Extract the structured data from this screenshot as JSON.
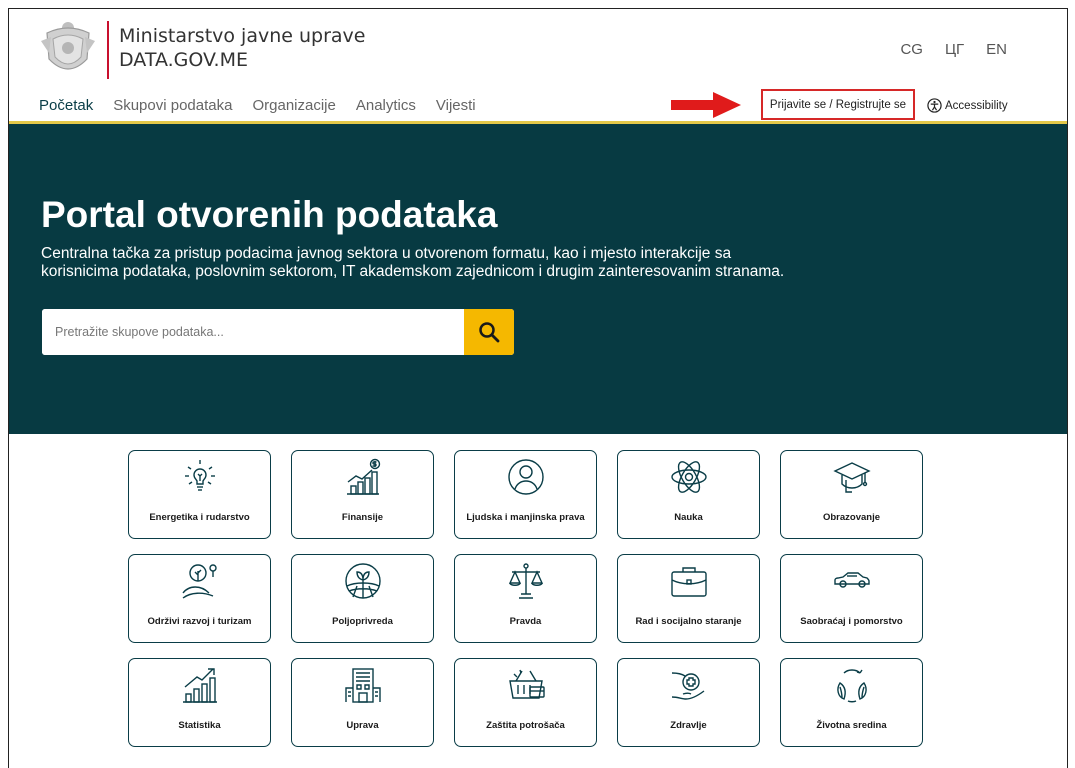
{
  "header": {
    "ministry": "Ministarstvo javne uprave",
    "site": "DATA.GOV.ME",
    "languages": [
      "CG",
      "ЦГ",
      "EN"
    ]
  },
  "nav": {
    "items": [
      "Početak",
      "Skupovi podataka",
      "Organizacije",
      "Analytics",
      "Vijesti"
    ],
    "login": "Prijavite se / Registrujte se",
    "accessibility": "Accessibility"
  },
  "hero": {
    "title": "Portal otvorenih podataka",
    "description": "Centralna tačka za pristup podacima javnog sektora u otvorenom formatu, kao i mjesto interakcije sa korisnicima podataka, poslovnim sektorom, IT akademskom zajednicom i drugim zainteresovanim stranama.",
    "search_placeholder": "Pretražite skupove podataka..."
  },
  "categories": [
    {
      "label": "Energetika i rudarstvo",
      "icon": "lightbulb-icon"
    },
    {
      "label": "Finansije",
      "icon": "finance-chart-icon"
    },
    {
      "label": "Ljudska i manjinska prava",
      "icon": "person-icon"
    },
    {
      "label": "Nauka",
      "icon": "atom-icon"
    },
    {
      "label": "Obrazovanje",
      "icon": "graduation-cap-icon"
    },
    {
      "label": "Održivi razvoj i turizam",
      "icon": "sprout-icon"
    },
    {
      "label": "Poljoprivreda",
      "icon": "field-icon"
    },
    {
      "label": "Pravda",
      "icon": "scales-icon"
    },
    {
      "label": "Rad i socijalno staranje",
      "icon": "briefcase-icon"
    },
    {
      "label": "Saobraćaj i pomorstvo",
      "icon": "car-icon"
    },
    {
      "label": "Statistika",
      "icon": "growth-chart-icon"
    },
    {
      "label": "Uprava",
      "icon": "building-icon"
    },
    {
      "label": "Zaštita potrošača",
      "icon": "basket-icon"
    },
    {
      "label": "Zdravlje",
      "icon": "health-hand-icon"
    },
    {
      "label": "Životna sredina",
      "icon": "leaves-icon"
    }
  ],
  "colors": {
    "hero_bg": "#073a42",
    "accent_red": "#c8102e",
    "search_button": "#f5b800",
    "nav_underline": "#e4c84a"
  }
}
